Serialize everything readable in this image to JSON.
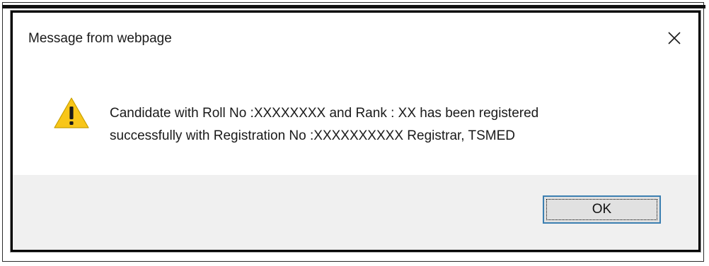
{
  "dialog": {
    "title": "Message from webpage",
    "close_icon": "close-icon",
    "warning_icon": "warning-icon",
    "message_line1": "Candidate with Roll No :XXXXXXXX and Rank : XX has been registered",
    "message_line2": "successfully with Registration No :XXXXXXXXXX Registrar, TSMED",
    "ok_label": "OK"
  },
  "colors": {
    "footer_bg": "#f0f0f0",
    "button_bg": "#e1e1e1",
    "button_border_focus": "#3c7fb1",
    "warning_yellow": "#f8c619"
  }
}
